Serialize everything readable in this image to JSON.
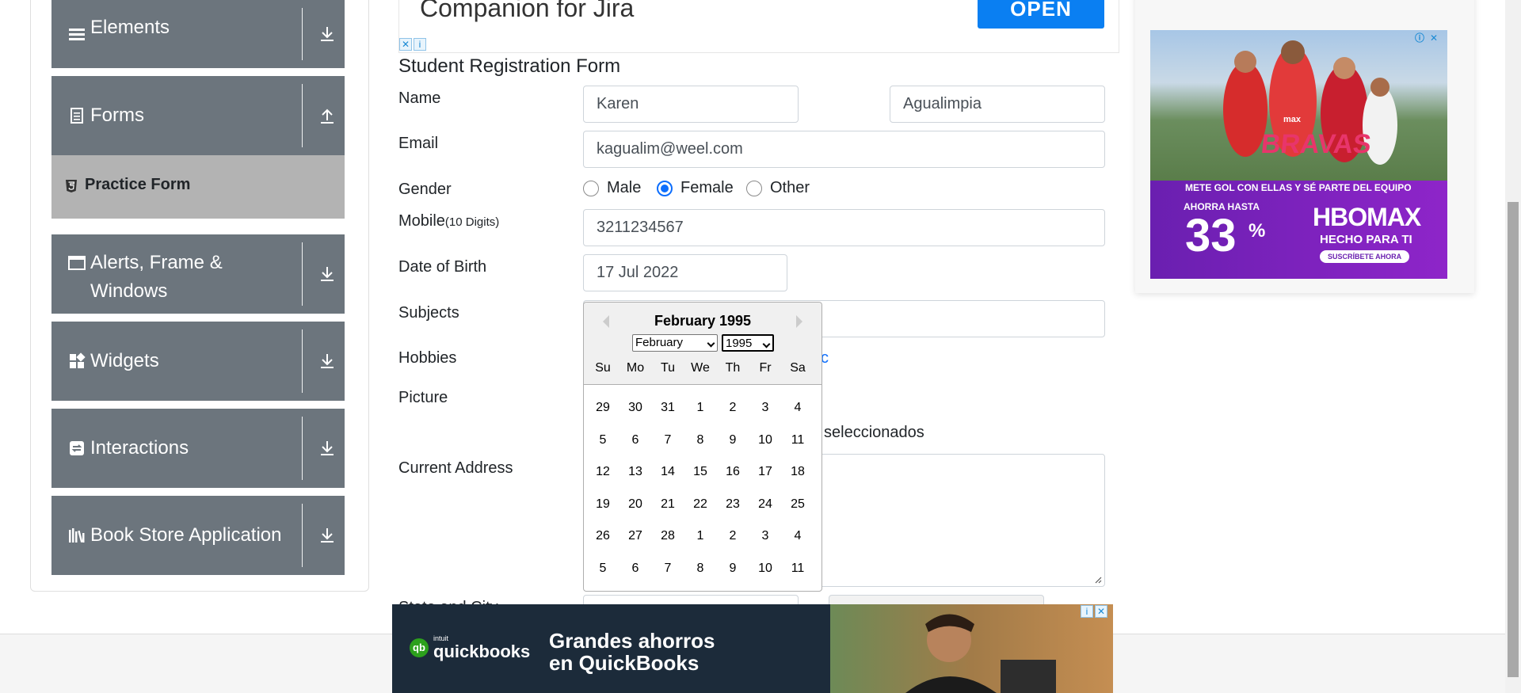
{
  "sidebar": {
    "groups": [
      {
        "label": "Elements",
        "icon": "menu-icon",
        "arrow": "download-arrow-icon"
      },
      {
        "label": "Forms",
        "icon": "document-icon",
        "arrow": "upload-arrow-icon"
      },
      {
        "label": "Alerts, Frame &",
        "label2": "Windows",
        "icon": "window-icon",
        "arrow": "download-arrow-icon"
      },
      {
        "label": "Widgets",
        "icon": "widgets-icon",
        "arrow": "download-arrow-icon"
      },
      {
        "label": "Interactions",
        "icon": "interactions-icon",
        "arrow": "download-arrow-icon"
      },
      {
        "label": "Book Store Application",
        "icon": "books-icon",
        "arrow": "download-arrow-icon"
      }
    ],
    "active_item": {
      "label": "Practice Form",
      "icon": "html5-icon"
    }
  },
  "top_ad": {
    "text": "Companion for Jira",
    "button": "OPEN"
  },
  "form": {
    "title": "Student Registration Form",
    "labels": {
      "name": "Name",
      "email": "Email",
      "gender": "Gender",
      "mobile": "Mobile",
      "mobile_hint": "(10 Digits)",
      "dob": "Date of Birth",
      "subjects": "Subjects",
      "hobbies": "Hobbies",
      "picture": "Picture",
      "address": "Current Address",
      "state_city": "State and City"
    },
    "values": {
      "first_name": "Karen",
      "last_name": "Agualimpia",
      "email": "kagualim@weel.com",
      "mobile": "3211234567",
      "dob": "17 Jul 2022"
    },
    "gender_options": [
      "Male",
      "Female",
      "Other"
    ],
    "gender_selected": "Female",
    "partial_texts": {
      "hobby_tail": "c",
      "picture_tail": "seleccionados"
    }
  },
  "datepicker": {
    "title": "February 1995",
    "month_select": "February",
    "year_select": "1995",
    "day_names": [
      "Su",
      "Mo",
      "Tu",
      "We",
      "Th",
      "Fr",
      "Sa"
    ],
    "weeks": [
      [
        "29",
        "30",
        "31",
        "1",
        "2",
        "3",
        "4"
      ],
      [
        "5",
        "6",
        "7",
        "8",
        "9",
        "10",
        "11"
      ],
      [
        "12",
        "13",
        "14",
        "15",
        "16",
        "17",
        "18"
      ],
      [
        "19",
        "20",
        "21",
        "22",
        "23",
        "24",
        "25"
      ],
      [
        "26",
        "27",
        "28",
        "1",
        "2",
        "3",
        "4"
      ],
      [
        "5",
        "6",
        "7",
        "8",
        "9",
        "10",
        "11"
      ]
    ]
  },
  "right_ad": {
    "brand_top": "max",
    "show": "BRAVAS",
    "tagline": "METE GOL CON ELLAS Y SÉ PARTE DEL EQUIPO",
    "discount_label": "AHORRA HASTA",
    "discount": "33",
    "percent": "%",
    "brand": "HBOMAX",
    "brand_sub": "HECHO PARA TI",
    "cta": "SUSCRÍBETE AHORA"
  },
  "bottom_ad": {
    "logo_small": "intuit",
    "logo": "quickbooks",
    "headline1": "Grandes ahorros",
    "headline2": "en QuickBooks"
  },
  "colors": {
    "sidebar_group_bg": "#6c757d",
    "active_item_bg": "#b3b3b3",
    "accent_blue": "#0d6efd",
    "open_button": "#0a7ff2"
  }
}
